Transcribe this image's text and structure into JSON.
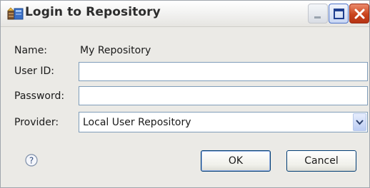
{
  "window": {
    "title": "Login to Repository",
    "icon": "repository-icon",
    "controls": [
      "minimize-icon",
      "maximize-icon",
      "close-icon"
    ]
  },
  "form": {
    "name_label": "Name:",
    "name_value": "My Repository",
    "userid_label": "User ID:",
    "userid_value": "",
    "password_label": "Password:",
    "password_value": "",
    "provider_label": "Provider:",
    "provider_value": "Local User Repository"
  },
  "buttons": {
    "help_icon": "help-icon",
    "ok_label": "OK",
    "cancel_label": "Cancel"
  },
  "colors": {
    "titlebar": "#f3f3f2",
    "field_border": "#7f9db9",
    "close_button": "#c9441d",
    "dialog_background": "#ebeae6"
  }
}
